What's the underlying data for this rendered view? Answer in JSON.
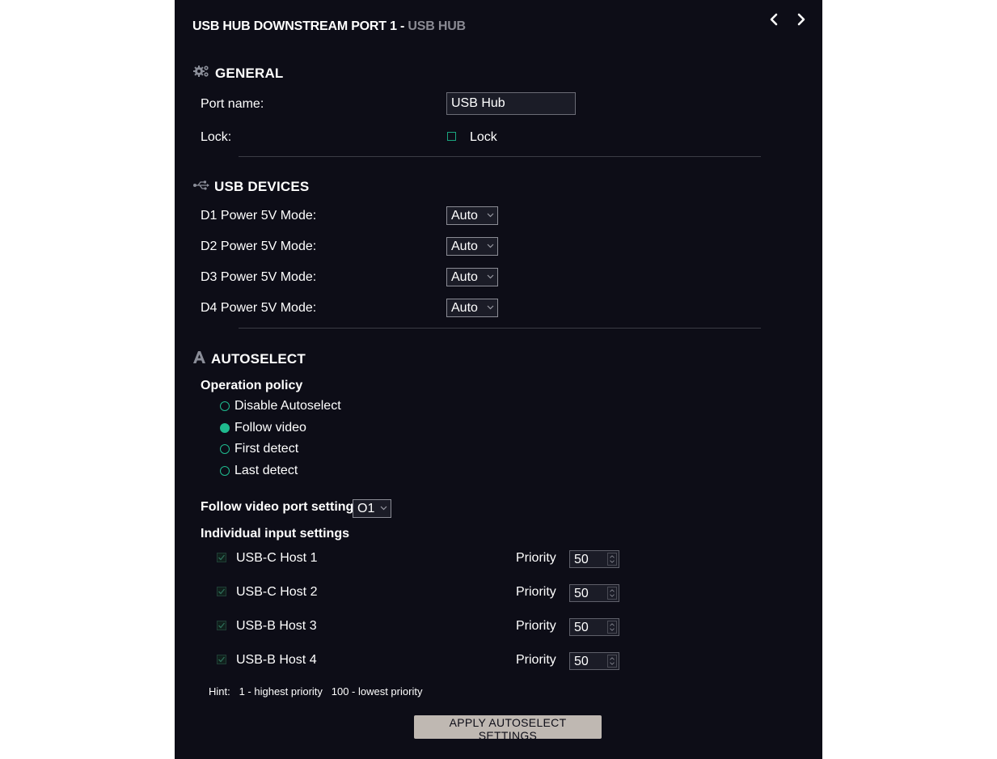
{
  "header": {
    "title_main": "USB HUB DOWNSTREAM PORT 1 - ",
    "title_sub": "USB HUB"
  },
  "general": {
    "heading": "GENERAL",
    "port_name_label": "Port name:",
    "port_name_value": "USB Hub",
    "lock_label": "Lock:",
    "lock_checkbox_label": "Lock"
  },
  "usb_devices": {
    "heading": "USB DEVICES",
    "rows": [
      {
        "label": "D1 Power 5V Mode:",
        "value": "Auto"
      },
      {
        "label": "D2 Power 5V Mode:",
        "value": "Auto"
      },
      {
        "label": "D3 Power 5V Mode:",
        "value": "Auto"
      },
      {
        "label": "D4 Power 5V Mode:",
        "value": "Auto"
      }
    ]
  },
  "autoselect": {
    "heading": "AUTOSELECT",
    "policy_label": "Operation policy",
    "policies": [
      {
        "label": "Disable Autoselect",
        "selected": false
      },
      {
        "label": "Follow video",
        "selected": true
      },
      {
        "label": "First detect",
        "selected": false
      },
      {
        "label": "Last detect",
        "selected": false
      }
    ],
    "follow_video_label": "Follow video port setting",
    "follow_video_value": "O1",
    "individual_label": "Individual input settings",
    "priority_label": "Priority",
    "hosts": [
      {
        "label": "USB-C Host 1",
        "priority": "50",
        "checked": true
      },
      {
        "label": "USB-C Host 2",
        "priority": "50",
        "checked": true
      },
      {
        "label": "USB-B Host 3",
        "priority": "50",
        "checked": true
      },
      {
        "label": "USB-B Host 4",
        "priority": "50",
        "checked": true
      }
    ],
    "hint_label": "Hint:",
    "hint_text": "1 - highest priority   100 - lowest priority",
    "apply_label": "APPLY AUTOSELECT SETTINGS"
  },
  "colors": {
    "background": "#0d0d17",
    "accent": "#1fba8e",
    "button": "#bfb8b2"
  }
}
